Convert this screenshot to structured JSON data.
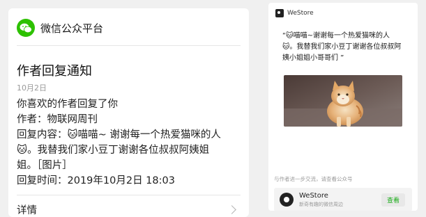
{
  "left_card": {
    "platform_name": "微信公众平台",
    "title": "作者回复通知",
    "date": "10月2日",
    "lines": {
      "intro": "你喜欢的作者回复了你",
      "author": "作者：物联网周刊",
      "reply_prefix": "回复内容：",
      "reply_emoji": "🐱",
      "reply_text_1": "喵喵~ 谢谢每一个热爱猫咪的人",
      "reply_emoji_2": "🐱",
      "reply_text_2": "。我替我们家小豆丁谢谢各位叔叔阿姨姐",
      "reply_text_3": "姐。［图片］",
      "reply_time": "回复时间：2019年10月2日 18:03"
    },
    "detail_label": "详情"
  },
  "right_card": {
    "store_name": "WeStore",
    "quote_line_1": "“🐱喵喵~谢谢每一个热爱猫咪的人",
    "quote_line_2": "🐱。我替我们家小豆丁谢谢各位叔叔阿",
    "quote_line_3": "姨小姐姐小哥哥们 ”",
    "footer_hint": "与作者进一步交流，请查看公众号",
    "promo": {
      "name": "WeStore",
      "subtitle": "新奇有趣的微信周边",
      "button_label": "查看"
    }
  },
  "colors": {
    "wechat_green": "#2dc100",
    "link_green": "#1aad19",
    "background": "#f0f0f0"
  },
  "icons": {
    "wechat_logo": "wechat-logo-icon",
    "chevron": "chevron-right-icon",
    "store_logo": "westore-logo-icon"
  }
}
